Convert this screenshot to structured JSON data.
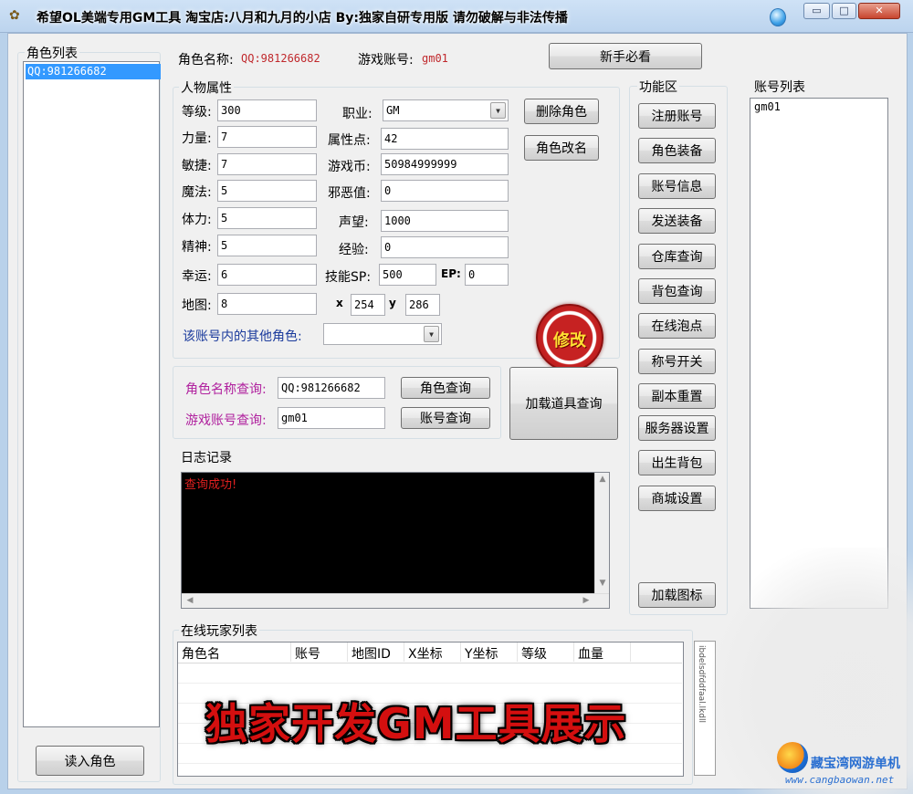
{
  "window": {
    "title": "希望OL美端专用GM工具 淘宝店:八月和九月的小店 By:独家自研专用版 请勿破解与非法传播",
    "min_glyph": "▭",
    "max_glyph": "□",
    "close_glyph": "✕"
  },
  "role_list": {
    "title": "角色列表",
    "items": [
      "QQ:981266682"
    ],
    "load_button": "读入角色"
  },
  "header": {
    "role_name_label": "角色名称:",
    "role_name_value": "QQ:981266682",
    "game_account_label": "游戏账号:",
    "game_account_value": "gm01",
    "newbie_button": "新手必看"
  },
  "attributes": {
    "title": "人物属性",
    "level_label": "等级:",
    "level": "300",
    "strength_label": "力量:",
    "strength": "7",
    "agility_label": "敏捷:",
    "agility": "7",
    "magic_label": "魔法:",
    "magic": "5",
    "stamina_label": "体力:",
    "stamina": "5",
    "spirit_label": "精神:",
    "spirit": "5",
    "luck_label": "幸运:",
    "luck": "6",
    "map_label": "地图:",
    "map": "8",
    "job_label": "职业:",
    "job": "GM",
    "attr_points_label": "属性点:",
    "attr_points": "42",
    "gold_label": "游戏币:",
    "gold": "50984999999",
    "evil_label": "邪恶值:",
    "evil": "0",
    "fame_label": "声望:",
    "fame": "1000",
    "exp_label": "经验:",
    "exp": "0",
    "sp_label": "技能SP:",
    "sp": "500",
    "ep_label": "EP:",
    "ep": "0",
    "x_label": "x",
    "x": "254",
    "y_label": "y",
    "y": "286",
    "other_roles_label": "该账号内的其他角色:",
    "delete_role_button": "删除角色",
    "rename_role_button": "角色改名",
    "modify_button": "修改"
  },
  "query": {
    "role_query_label": "角色名称查询:",
    "role_query_value": "QQ:981266682",
    "account_query_label": "游戏账号查询:",
    "account_query_value": "gm01",
    "role_query_button": "角色查询",
    "account_query_button": "账号查询",
    "load_items_button": "加载道具查询"
  },
  "log": {
    "title": "日志记录",
    "text": "查询成功!"
  },
  "functions": {
    "title": "功能区",
    "buttons": [
      "注册账号",
      "角色装备",
      "账号信息",
      "发送装备",
      "仓库查询",
      "背包查询",
      "在线泡点",
      "称号开关",
      "副本重置",
      "服务器设置",
      "出生背包",
      "商城设置"
    ],
    "load_icon_button": "加载图标"
  },
  "accounts": {
    "title": "账号列表",
    "items": [
      "gm01"
    ]
  },
  "online": {
    "title": "在线玩家列表",
    "columns": [
      "角色名",
      "账号",
      "地图ID",
      "X坐标",
      "Y坐标",
      "等级",
      "血量"
    ]
  },
  "overlay": {
    "banner": "独家开发GM工具展示",
    "side_strip_text": "ibdelsdfddfaal.lkdll",
    "watermark_title": "藏宝湾网游单机",
    "watermark_url": "www.cangbaowan.net"
  }
}
